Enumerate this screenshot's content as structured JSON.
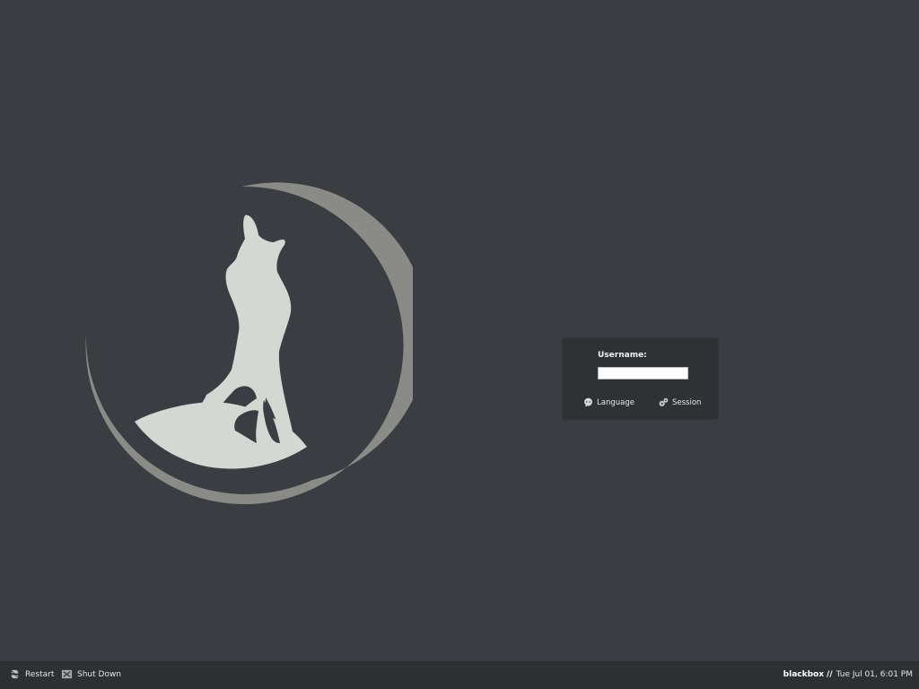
{
  "background_color": "#3a3e42",
  "logo": {
    "icon": "howling-wolf-moon-logo",
    "moon_color": "#8a8b86",
    "wolf_color": "#d5d7d2"
  },
  "login": {
    "username_label": "Username:",
    "username_value": "",
    "language_label": "Language",
    "language_icon": "speech-bubble-icon",
    "session_label": "Session",
    "session_icon": "gears-icon"
  },
  "bottom_bar": {
    "restart_label": "Restart",
    "restart_icon": "restart-icon",
    "shutdown_label": "Shut Down",
    "shutdown_icon": "shutdown-icon",
    "hostname": "blackbox",
    "separator": "//",
    "datetime": "Tue Jul 01,  6:01 PM"
  }
}
